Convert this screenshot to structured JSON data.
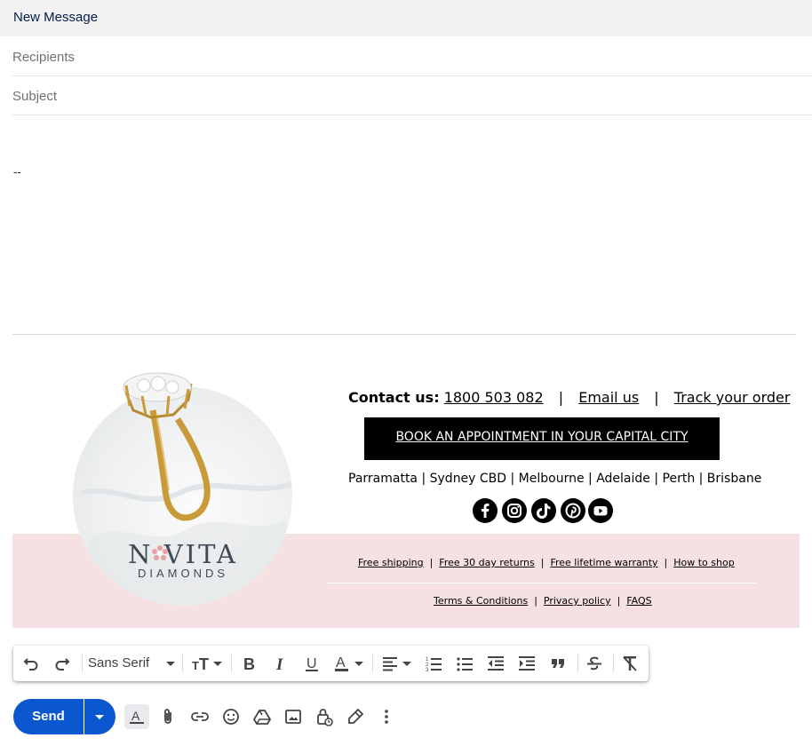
{
  "header": {
    "title": "New Message"
  },
  "fields": {
    "recipients_placeholder": "Recipients",
    "subject_placeholder": "Subject"
  },
  "body": {
    "text": "--"
  },
  "signature": {
    "logo_main": "N VITA",
    "logo_sub": "DIAMONDS",
    "contact_label": "Contact us:",
    "phone": "1800 503 082",
    "email_link": "Email us",
    "track_link": "Track your order",
    "sep": "|",
    "book_button": "BOOK AN APPOINTMENT IN YOUR CAPITAL CITY",
    "cities": "Parramatta | Sydney CBD |  Melbourne | Adelaide | Perth | Brisbane",
    "social": [
      "facebook-icon",
      "instagram-icon",
      "tiktok-icon",
      "pinterest-icon",
      "youtube-icon"
    ],
    "links_row1": [
      "Free shipping",
      "Free 30 day returns",
      "Free lifetime warranty",
      "How to shop"
    ],
    "links_row2": [
      "Terms & Conditions",
      "Privacy policy",
      "FAQS"
    ]
  },
  "toolbar": {
    "font": "Sans Serif",
    "icons": [
      "undo-icon",
      "redo-icon",
      "font-size-icon",
      "bold-icon",
      "italic-icon",
      "underline-icon",
      "text-color-icon",
      "align-icon",
      "numbered-list-icon",
      "bulleted-list-icon",
      "indent-less-icon",
      "indent-more-icon",
      "quote-icon",
      "strikethrough-icon",
      "remove-formatting-icon"
    ]
  },
  "actions": {
    "send_label": "Send",
    "icons": [
      "formatting-options-icon",
      "attach-icon",
      "link-icon",
      "emoji-icon",
      "drive-icon",
      "photo-icon",
      "confidential-icon",
      "signature-icon",
      "more-options-icon"
    ]
  },
  "colors": {
    "send": "#0b57d0",
    "pink_band": "#f5e1e1",
    "header_bg": "#f2f2f2"
  }
}
